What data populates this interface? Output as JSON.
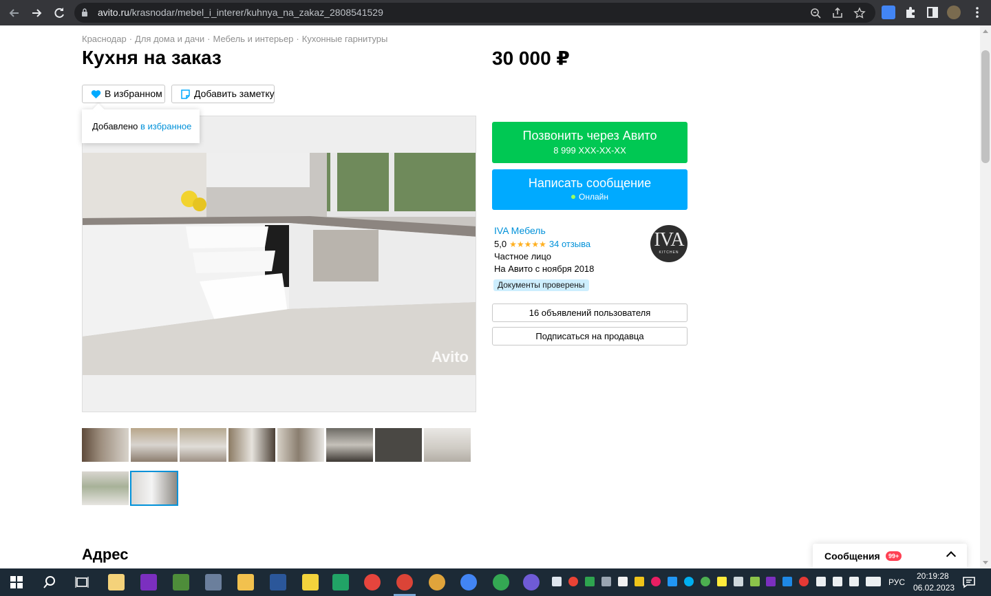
{
  "browser": {
    "url_host": "avito.ru",
    "url_path": "/krasnodar/mebel_i_interer/kuhnya_na_zakaz_2808541529"
  },
  "breadcrumbs": [
    "Краснодар",
    "Для дома и дачи",
    "Мебель и интерьер",
    "Кухонные гарнитуры"
  ],
  "listing": {
    "title": "Кухня на заказ",
    "price": "30 000 ₽",
    "favorite_label": "В избранном",
    "note_label": "Добавить заметку",
    "tooltip_text": "Добавлено ",
    "tooltip_link": "в избранное",
    "watermark": "Avito",
    "address_heading": "Адрес"
  },
  "contact": {
    "call_label": "Позвонить через Авито",
    "call_phone": "8 999 XXX-XX-XX",
    "message_label": "Написать сообщение",
    "online_label": "Онлайн"
  },
  "seller": {
    "name": "IVA Мебель",
    "rating": "5,0",
    "stars": "★★★★★",
    "reviews": "34 отзыва",
    "type": "Частное лицо",
    "since": "На Авито с ноября 2018",
    "docs_badge": "Документы проверены",
    "avatar_big": "IVA",
    "avatar_small": "KITCHEN",
    "listings_button": "16 объявлений пользователя",
    "subscribe_button": "Подписаться на продавца"
  },
  "messenger": {
    "label": "Сообщения",
    "badge": "99+"
  },
  "taskbar": {
    "language": "РУС",
    "time": "20:19:28",
    "date": "06.02.2023"
  },
  "colors": {
    "call_green": "#00c853",
    "message_blue": "#00aaff",
    "link_blue": "#0091d9",
    "star_orange": "#ffb021",
    "badge_red": "#ff4053"
  }
}
